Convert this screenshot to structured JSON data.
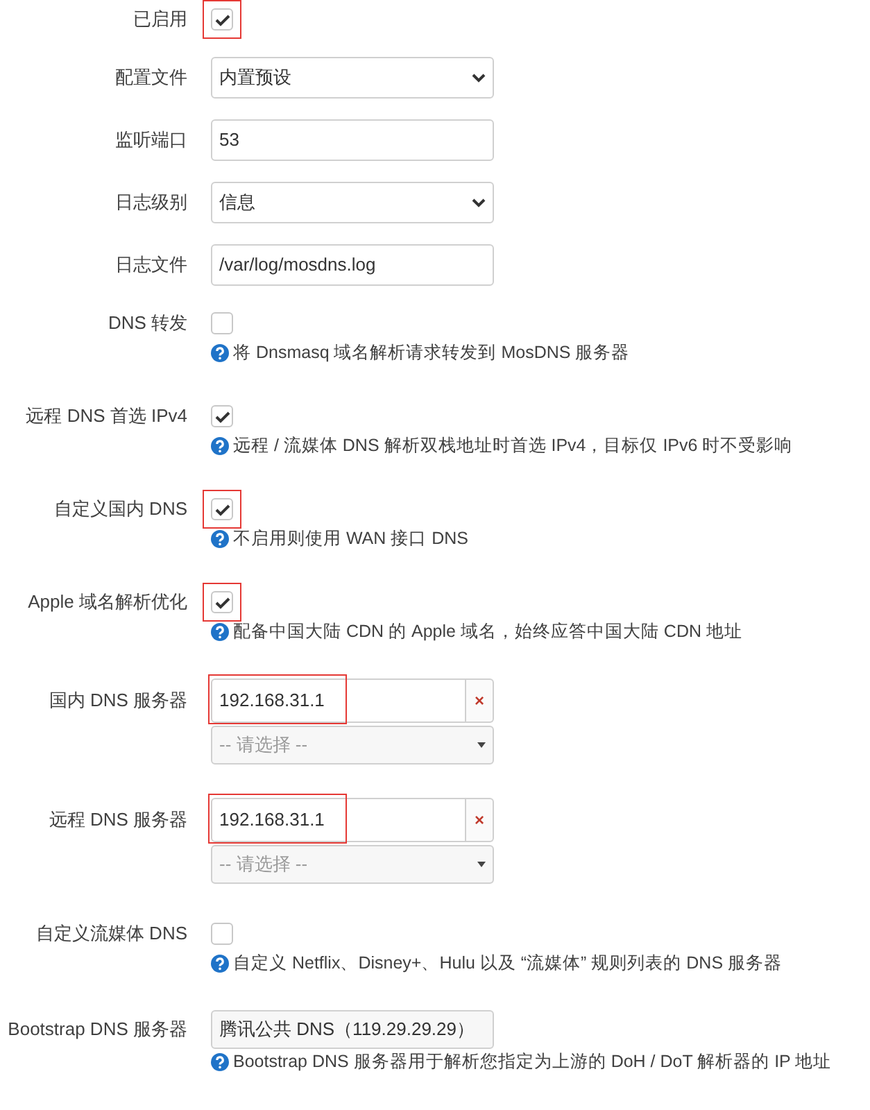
{
  "rows": [
    {
      "kind": "checkbox",
      "label": "已启用",
      "checked": true,
      "highlighted": true
    },
    {
      "kind": "select",
      "label": "配置文件",
      "value": "内置预设"
    },
    {
      "kind": "text",
      "label": "监听端口",
      "value": "53"
    },
    {
      "kind": "select",
      "label": "日志级别",
      "value": "信息"
    },
    {
      "kind": "text",
      "label": "日志文件",
      "value": "/var/log/mosdns.log"
    },
    {
      "kind": "checkbox",
      "label": "DNS 转发",
      "checked": false,
      "highlighted": false,
      "help": "将 Dnsmasq 域名解析请求转发到 MosDNS 服务器"
    },
    {
      "kind": "checkbox",
      "label": "远程 DNS 首选 IPv4",
      "checked": true,
      "highlighted": false,
      "help": "远程 / 流媒体 DNS 解析双栈地址时首选 IPv4，目标仅 IPv6 时不受影响"
    },
    {
      "kind": "checkbox",
      "label": "自定义国内 DNS",
      "checked": true,
      "highlighted": true,
      "help": "不启用则使用 WAN 接口 DNS"
    },
    {
      "kind": "checkbox",
      "label": "Apple 域名解析优化",
      "checked": true,
      "highlighted": true,
      "help": "配备中国大陆 CDN 的 Apple 域名，始终应答中国大陆 CDN 地址"
    },
    {
      "kind": "dynlist",
      "label": "国内 DNS 服务器",
      "value": "192.168.31.1",
      "highlighted": true,
      "remove": "×",
      "choose": "-- 请选择 --"
    },
    {
      "kind": "dynlist",
      "label": "远程 DNS 服务器",
      "value": "192.168.31.1",
      "highlighted": true,
      "remove": "×",
      "choose": "-- 请选择 --"
    },
    {
      "kind": "checkbox",
      "label": "自定义流媒体 DNS",
      "checked": false,
      "highlighted": false,
      "help": "自定义 Netflix、Disney+、Hulu 以及 “流媒体” 规则列表的 DNS 服务器"
    },
    {
      "kind": "combo",
      "label": "Bootstrap DNS 服务器",
      "value": "腾讯公共 DNS（119.29.29.29）",
      "help": "Bootstrap DNS 服务器用于解析您指定为上游的 DoH / DoT 解析器的 IP 地址"
    }
  ]
}
